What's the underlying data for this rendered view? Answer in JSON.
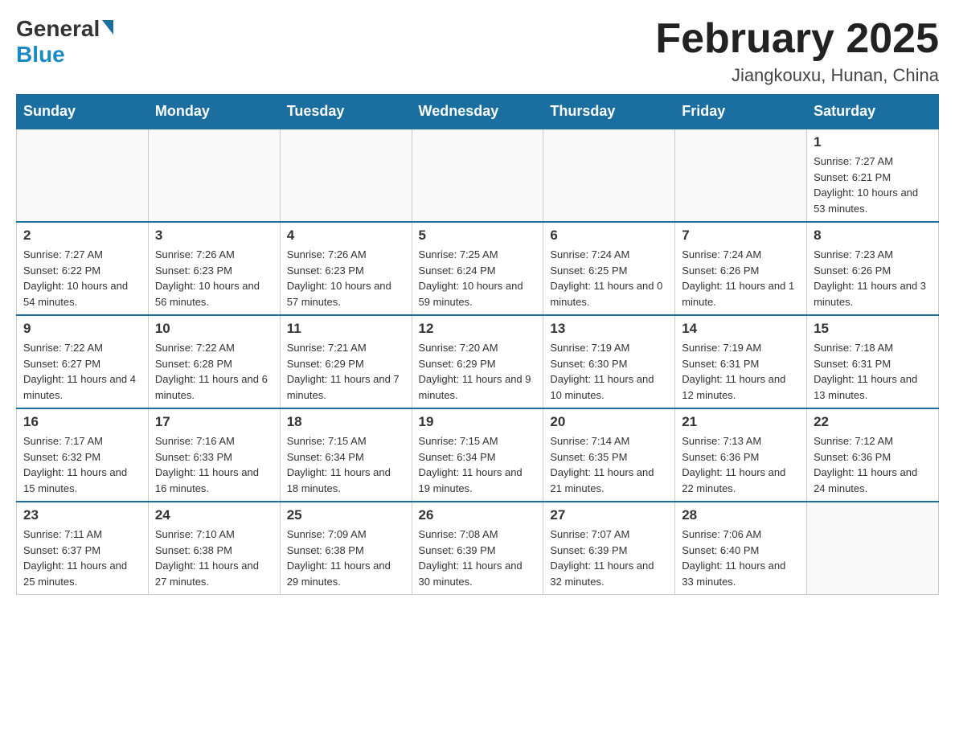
{
  "header": {
    "logo_general": "General",
    "logo_blue": "Blue",
    "month_title": "February 2025",
    "location": "Jiangkouxu, Hunan, China"
  },
  "weekdays": [
    "Sunday",
    "Monday",
    "Tuesday",
    "Wednesday",
    "Thursday",
    "Friday",
    "Saturday"
  ],
  "weeks": [
    [
      {
        "day": "",
        "sunrise": "",
        "sunset": "",
        "daylight": ""
      },
      {
        "day": "",
        "sunrise": "",
        "sunset": "",
        "daylight": ""
      },
      {
        "day": "",
        "sunrise": "",
        "sunset": "",
        "daylight": ""
      },
      {
        "day": "",
        "sunrise": "",
        "sunset": "",
        "daylight": ""
      },
      {
        "day": "",
        "sunrise": "",
        "sunset": "",
        "daylight": ""
      },
      {
        "day": "",
        "sunrise": "",
        "sunset": "",
        "daylight": ""
      },
      {
        "day": "1",
        "sunrise": "Sunrise: 7:27 AM",
        "sunset": "Sunset: 6:21 PM",
        "daylight": "Daylight: 10 hours and 53 minutes."
      }
    ],
    [
      {
        "day": "2",
        "sunrise": "Sunrise: 7:27 AM",
        "sunset": "Sunset: 6:22 PM",
        "daylight": "Daylight: 10 hours and 54 minutes."
      },
      {
        "day": "3",
        "sunrise": "Sunrise: 7:26 AM",
        "sunset": "Sunset: 6:23 PM",
        "daylight": "Daylight: 10 hours and 56 minutes."
      },
      {
        "day": "4",
        "sunrise": "Sunrise: 7:26 AM",
        "sunset": "Sunset: 6:23 PM",
        "daylight": "Daylight: 10 hours and 57 minutes."
      },
      {
        "day": "5",
        "sunrise": "Sunrise: 7:25 AM",
        "sunset": "Sunset: 6:24 PM",
        "daylight": "Daylight: 10 hours and 59 minutes."
      },
      {
        "day": "6",
        "sunrise": "Sunrise: 7:24 AM",
        "sunset": "Sunset: 6:25 PM",
        "daylight": "Daylight: 11 hours and 0 minutes."
      },
      {
        "day": "7",
        "sunrise": "Sunrise: 7:24 AM",
        "sunset": "Sunset: 6:26 PM",
        "daylight": "Daylight: 11 hours and 1 minute."
      },
      {
        "day": "8",
        "sunrise": "Sunrise: 7:23 AM",
        "sunset": "Sunset: 6:26 PM",
        "daylight": "Daylight: 11 hours and 3 minutes."
      }
    ],
    [
      {
        "day": "9",
        "sunrise": "Sunrise: 7:22 AM",
        "sunset": "Sunset: 6:27 PM",
        "daylight": "Daylight: 11 hours and 4 minutes."
      },
      {
        "day": "10",
        "sunrise": "Sunrise: 7:22 AM",
        "sunset": "Sunset: 6:28 PM",
        "daylight": "Daylight: 11 hours and 6 minutes."
      },
      {
        "day": "11",
        "sunrise": "Sunrise: 7:21 AM",
        "sunset": "Sunset: 6:29 PM",
        "daylight": "Daylight: 11 hours and 7 minutes."
      },
      {
        "day": "12",
        "sunrise": "Sunrise: 7:20 AM",
        "sunset": "Sunset: 6:29 PM",
        "daylight": "Daylight: 11 hours and 9 minutes."
      },
      {
        "day": "13",
        "sunrise": "Sunrise: 7:19 AM",
        "sunset": "Sunset: 6:30 PM",
        "daylight": "Daylight: 11 hours and 10 minutes."
      },
      {
        "day": "14",
        "sunrise": "Sunrise: 7:19 AM",
        "sunset": "Sunset: 6:31 PM",
        "daylight": "Daylight: 11 hours and 12 minutes."
      },
      {
        "day": "15",
        "sunrise": "Sunrise: 7:18 AM",
        "sunset": "Sunset: 6:31 PM",
        "daylight": "Daylight: 11 hours and 13 minutes."
      }
    ],
    [
      {
        "day": "16",
        "sunrise": "Sunrise: 7:17 AM",
        "sunset": "Sunset: 6:32 PM",
        "daylight": "Daylight: 11 hours and 15 minutes."
      },
      {
        "day": "17",
        "sunrise": "Sunrise: 7:16 AM",
        "sunset": "Sunset: 6:33 PM",
        "daylight": "Daylight: 11 hours and 16 minutes."
      },
      {
        "day": "18",
        "sunrise": "Sunrise: 7:15 AM",
        "sunset": "Sunset: 6:34 PM",
        "daylight": "Daylight: 11 hours and 18 minutes."
      },
      {
        "day": "19",
        "sunrise": "Sunrise: 7:15 AM",
        "sunset": "Sunset: 6:34 PM",
        "daylight": "Daylight: 11 hours and 19 minutes."
      },
      {
        "day": "20",
        "sunrise": "Sunrise: 7:14 AM",
        "sunset": "Sunset: 6:35 PM",
        "daylight": "Daylight: 11 hours and 21 minutes."
      },
      {
        "day": "21",
        "sunrise": "Sunrise: 7:13 AM",
        "sunset": "Sunset: 6:36 PM",
        "daylight": "Daylight: 11 hours and 22 minutes."
      },
      {
        "day": "22",
        "sunrise": "Sunrise: 7:12 AM",
        "sunset": "Sunset: 6:36 PM",
        "daylight": "Daylight: 11 hours and 24 minutes."
      }
    ],
    [
      {
        "day": "23",
        "sunrise": "Sunrise: 7:11 AM",
        "sunset": "Sunset: 6:37 PM",
        "daylight": "Daylight: 11 hours and 25 minutes."
      },
      {
        "day": "24",
        "sunrise": "Sunrise: 7:10 AM",
        "sunset": "Sunset: 6:38 PM",
        "daylight": "Daylight: 11 hours and 27 minutes."
      },
      {
        "day": "25",
        "sunrise": "Sunrise: 7:09 AM",
        "sunset": "Sunset: 6:38 PM",
        "daylight": "Daylight: 11 hours and 29 minutes."
      },
      {
        "day": "26",
        "sunrise": "Sunrise: 7:08 AM",
        "sunset": "Sunset: 6:39 PM",
        "daylight": "Daylight: 11 hours and 30 minutes."
      },
      {
        "day": "27",
        "sunrise": "Sunrise: 7:07 AM",
        "sunset": "Sunset: 6:39 PM",
        "daylight": "Daylight: 11 hours and 32 minutes."
      },
      {
        "day": "28",
        "sunrise": "Sunrise: 7:06 AM",
        "sunset": "Sunset: 6:40 PM",
        "daylight": "Daylight: 11 hours and 33 minutes."
      },
      {
        "day": "",
        "sunrise": "",
        "sunset": "",
        "daylight": ""
      }
    ]
  ]
}
